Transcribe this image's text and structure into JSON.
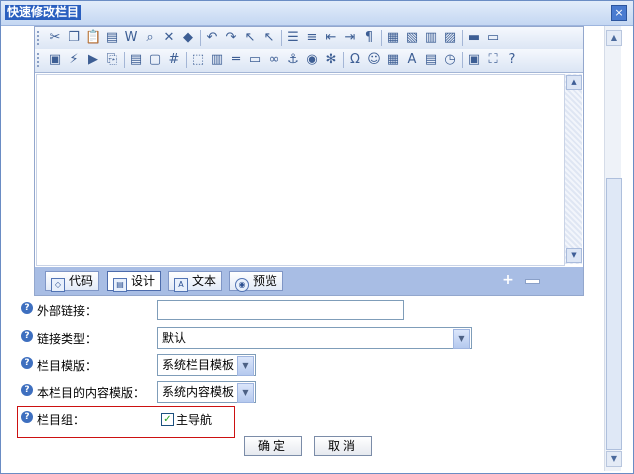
{
  "dialog": {
    "title": "快速修改栏目",
    "close_label": "×"
  },
  "toolbar1": [
    {
      "icon": "cut-icon",
      "glyph": "✂"
    },
    {
      "icon": "copy-icon",
      "glyph": "❐"
    },
    {
      "icon": "paste-icon",
      "glyph": "📋"
    },
    {
      "icon": "paste-text-icon",
      "glyph": "▤"
    },
    {
      "icon": "paste-word-icon",
      "glyph": "W"
    },
    {
      "icon": "find-icon",
      "glyph": "⌕"
    },
    {
      "icon": "delete-icon",
      "glyph": "✕"
    },
    {
      "icon": "eraser-icon",
      "glyph": "◆"
    },
    {
      "icon": "undo-icon",
      "glyph": "↶"
    },
    {
      "icon": "redo-icon",
      "glyph": "↷"
    },
    {
      "icon": "select-icon",
      "glyph": "↖"
    },
    {
      "icon": "pointer-icon",
      "glyph": "↖"
    },
    {
      "icon": "list-icon",
      "glyph": "☰"
    },
    {
      "icon": "list-ordered-icon",
      "glyph": "≡"
    },
    {
      "icon": "outdent-icon",
      "glyph": "⇤"
    },
    {
      "icon": "indent-icon",
      "glyph": "⇥"
    },
    {
      "icon": "paragraph-icon",
      "glyph": "¶"
    },
    {
      "icon": "table-insert-icon",
      "glyph": "▦"
    },
    {
      "icon": "table-edit-icon",
      "glyph": "▧"
    },
    {
      "icon": "cell-icon",
      "glyph": "▥"
    },
    {
      "icon": "merge-icon",
      "glyph": "▨"
    },
    {
      "icon": "format-icon",
      "glyph": "▬"
    },
    {
      "icon": "style-icon",
      "glyph": "▭"
    }
  ],
  "toolbar2": [
    {
      "icon": "image-icon",
      "glyph": "▣"
    },
    {
      "icon": "flash-icon",
      "glyph": "⚡"
    },
    {
      "icon": "media-icon",
      "glyph": "▶"
    },
    {
      "icon": "attachment-icon",
      "glyph": "⎘"
    },
    {
      "icon": "form-icon",
      "glyph": "▤"
    },
    {
      "icon": "frame-icon",
      "glyph": "▢"
    },
    {
      "icon": "grid-icon",
      "glyph": "#"
    },
    {
      "icon": "fieldset-icon",
      "glyph": "⬚"
    },
    {
      "icon": "textarea-icon",
      "glyph": "▥"
    },
    {
      "icon": "hr-icon",
      "glyph": "═"
    },
    {
      "icon": "marquee-icon",
      "glyph": "▭"
    },
    {
      "icon": "link-icon",
      "glyph": "∞"
    },
    {
      "icon": "anchor-icon",
      "glyph": "⚓"
    },
    {
      "icon": "web-icon",
      "glyph": "◉"
    },
    {
      "icon": "unlink-icon",
      "glyph": "✻"
    },
    {
      "icon": "omega-icon",
      "glyph": "Ω"
    },
    {
      "icon": "smiley-icon",
      "glyph": "☺"
    },
    {
      "icon": "excel-icon",
      "glyph": "▦"
    },
    {
      "icon": "font-icon",
      "glyph": "A"
    },
    {
      "icon": "date-icon",
      "glyph": "▤"
    },
    {
      "icon": "clock-icon",
      "glyph": "◷"
    },
    {
      "icon": "preview-icon",
      "glyph": "▣"
    },
    {
      "icon": "fullscreen-icon",
      "glyph": "⛶"
    },
    {
      "icon": "help-icon",
      "glyph": "?"
    }
  ],
  "modes": {
    "code": "代码",
    "design": "设计",
    "text": "文本",
    "preview": "预览"
  },
  "form": {
    "external_link_label": "外部链接：",
    "external_link_value": "",
    "link_type_label": "链接类型：",
    "link_type_value": "默认",
    "column_template_label": "栏目模版：",
    "column_template_value": "系统栏目模板",
    "content_template_label": "本栏目的内容模版：",
    "content_template_value": "系统内容模板",
    "column_group_label": "栏目组：",
    "main_nav_label": "主导航",
    "main_nav_checked": true
  },
  "buttons": {
    "ok": "确定",
    "cancel": "取消"
  },
  "colors": {
    "title_bg": "#2a5fbf",
    "mode_bar": "#a8bde4",
    "highlight": "#cc1111"
  }
}
